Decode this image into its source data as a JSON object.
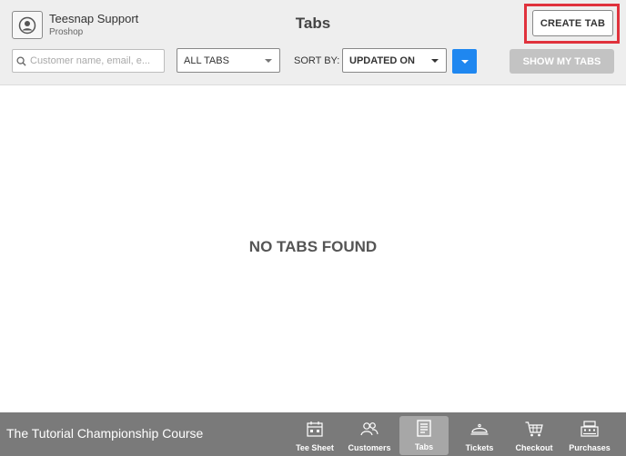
{
  "user": {
    "name": "Teesnap Support",
    "role": "Proshop"
  },
  "title": "Tabs",
  "create_tab_label": "CREATE TAB",
  "search": {
    "placeholder": "Customer name, email, e..."
  },
  "filter": {
    "selected": "ALL TABS"
  },
  "sort": {
    "label": "SORT BY:",
    "selected": "UPDATED ON"
  },
  "show_my_tabs_label": "SHOW MY TABS",
  "empty_message": "NO TABS FOUND",
  "course_name": "The Tutorial Championship Course",
  "nav": [
    {
      "label": "Tee Sheet",
      "icon": "calendar-icon"
    },
    {
      "label": "Customers",
      "icon": "people-icon"
    },
    {
      "label": "Tabs",
      "icon": "receipt-icon",
      "active": true
    },
    {
      "label": "Tickets",
      "icon": "cloche-icon"
    },
    {
      "label": "Checkout",
      "icon": "cart-icon"
    },
    {
      "label": "Purchases",
      "icon": "register-icon"
    }
  ],
  "colors": {
    "accent": "#1f87f0",
    "highlight": "#e0323c",
    "bottom_bar": "#7a7a7a"
  }
}
